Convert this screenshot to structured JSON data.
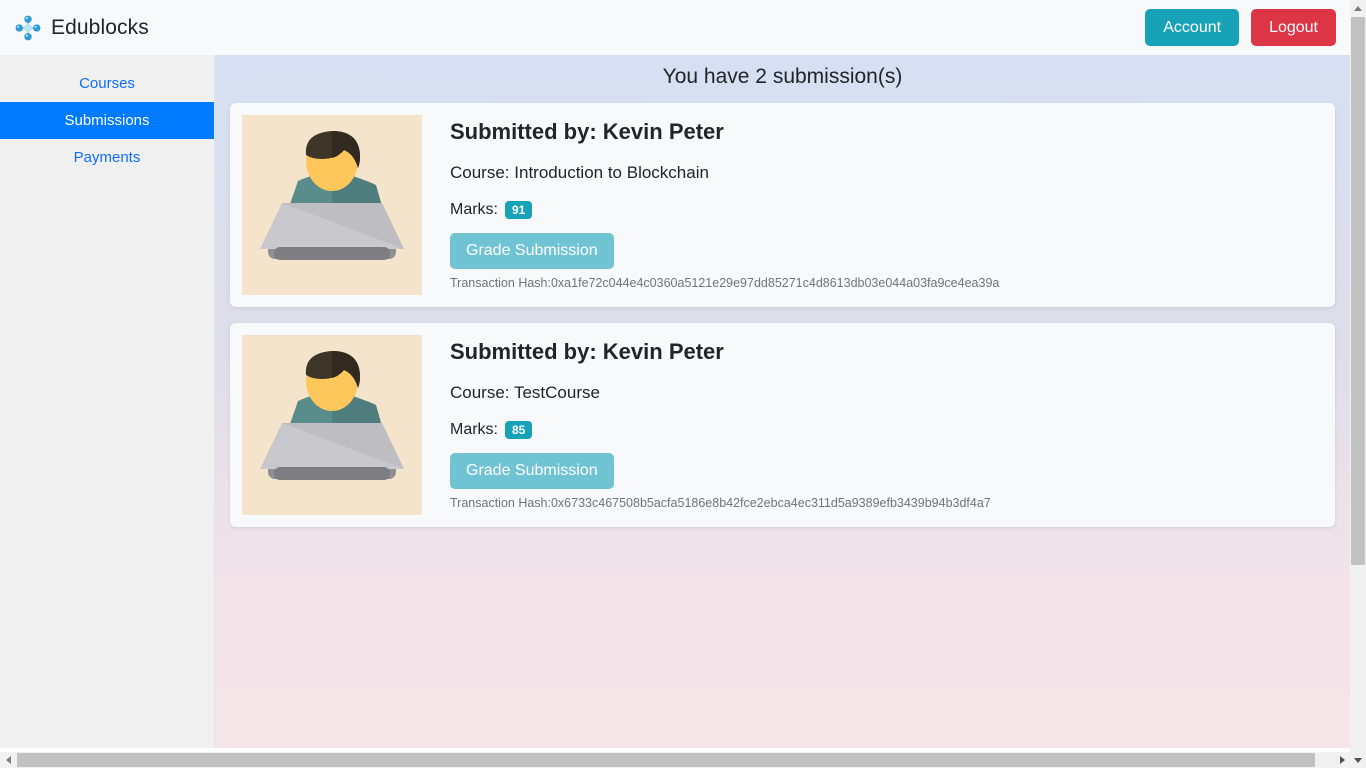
{
  "navbar": {
    "brand": "Edublocks",
    "logo_icon": "network-nodes-icon",
    "account_label": "Account",
    "logout_label": "Logout",
    "account_color": "#17a2b8",
    "logout_color": "#dc3545"
  },
  "sidebar": {
    "items": [
      {
        "label": "Courses",
        "active": false
      },
      {
        "label": "Submissions",
        "active": true
      },
      {
        "label": "Payments",
        "active": false
      }
    ],
    "active_color": "#007bff",
    "link_color": "#0d6efd"
  },
  "main": {
    "title": "You have 2 submission(s)",
    "badge_color": "#17a2b8",
    "grade_button_color": "#6fc3d2",
    "submissions": [
      {
        "avatar_icon": "person-at-laptop-avatar",
        "submitted_by_label": "Submitted by:",
        "student_name": "Kevin Peter",
        "course_label": "Course:",
        "course_name": "Introduction to Blockchain",
        "marks_label": "Marks:",
        "marks": "91",
        "grade_button_label": "Grade Submission",
        "tx_label": "Transaction Hash:",
        "tx_hash": "0xa1fe72c044e4c0360a5121e29e97dd85271c4d8613db03e044a03fa9ce4ea39a"
      },
      {
        "avatar_icon": "person-at-laptop-avatar",
        "submitted_by_label": "Submitted by:",
        "student_name": "Kevin Peter",
        "course_label": "Course:",
        "course_name": "TestCourse",
        "marks_label": "Marks:",
        "marks": "85",
        "grade_button_label": "Grade Submission",
        "tx_label": "Transaction Hash:",
        "tx_hash": "0x6733c467508b5acfa5186e8b42fce2ebca4ec311d5a9389efb3439b94b3df4a7"
      }
    ]
  }
}
